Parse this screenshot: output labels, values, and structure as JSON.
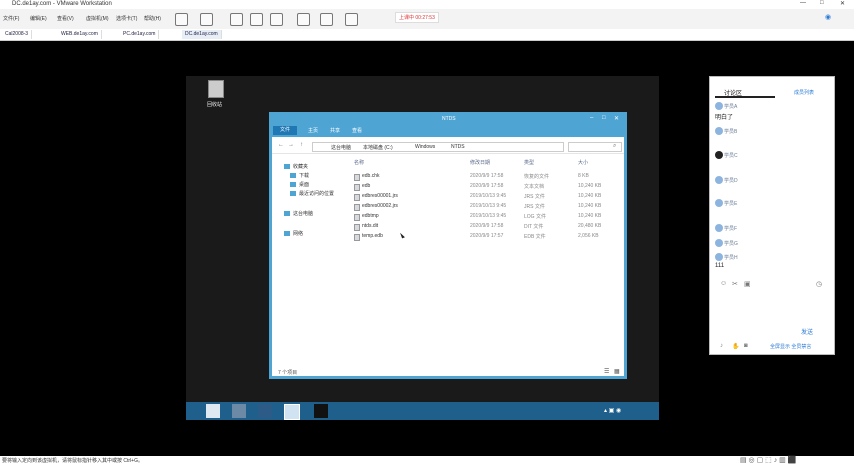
{
  "vmware": {
    "title": "DC.de1ay.com - VMware Workstation",
    "menu": [
      "文件(F)",
      "编辑(E)",
      "查看(V)",
      "虚拟机(M)",
      "选项卡(T)",
      "帮助(H)"
    ],
    "timer": "上课中 00:27:53",
    "tabs": [
      "Cal2008-3",
      "WEB.de1ay.com",
      "PC.de1ay.com",
      "DC.de1ay.com"
    ]
  },
  "desktop": {
    "recycle_bin_label": "回收站"
  },
  "explorer": {
    "title": "NTDS",
    "ribbon_tabs": [
      "文件",
      "主页",
      "共享",
      "查看"
    ],
    "breadcrumb": [
      "这台电脑",
      "本地磁盘 (C:)",
      "Windows",
      "NTDS"
    ],
    "nav_items": [
      {
        "label": "收藏夹",
        "icon": "star-icon"
      },
      {
        "label": "下载",
        "icon": "download-icon"
      },
      {
        "label": "桌面",
        "icon": "desktop-icon"
      },
      {
        "label": "最近访问的位置",
        "icon": "recent-icon"
      },
      {
        "label": "这台电脑",
        "icon": "computer-icon"
      },
      {
        "label": "网络",
        "icon": "network-icon"
      }
    ],
    "columns": [
      "名称",
      "修改日期",
      "类型",
      "大小"
    ],
    "files": [
      {
        "name": "edb.chk",
        "date": "2020/9/9 17:58",
        "type": "恢复的文件",
        "size": "8 KB"
      },
      {
        "name": "edb",
        "date": "2020/9/9 17:58",
        "type": "文本文档",
        "size": "10,240 KB"
      },
      {
        "name": "edbres00001.jrs",
        "date": "2019/10/13 9:45",
        "type": "JRS 文件",
        "size": "10,240 KB"
      },
      {
        "name": "edbres00002.jrs",
        "date": "2019/10/13 9:45",
        "type": "JRS 文件",
        "size": "10,240 KB"
      },
      {
        "name": "edbtmp",
        "date": "2019/10/13 9:45",
        "type": "LOG 文件",
        "size": "10,240 KB"
      },
      {
        "name": "ntds.dit",
        "date": "2020/9/9 17:58",
        "type": "DIT 文件",
        "size": "20,480 KB"
      },
      {
        "name": "temp.edb",
        "date": "2020/9/9 17:57",
        "type": "EDB 文件",
        "size": "2,056 KB"
      }
    ],
    "status": "7 个项目"
  },
  "chat": {
    "tab": "讨论区",
    "extra": "成员列表",
    "messages": [
      {
        "name": "学员A",
        "text": "明白了"
      },
      {
        "name": "学员B",
        "text": ""
      },
      {
        "name": "学员C",
        "text": ""
      },
      {
        "name": "学员D",
        "text": ""
      },
      {
        "name": "学员E",
        "text": ""
      },
      {
        "name": "学员F",
        "text": ""
      },
      {
        "name": "学员G",
        "text": ""
      },
      {
        "name": "学员H",
        "text": "111"
      }
    ],
    "send_label": "发送",
    "footer": "全屏显示 全员禁言"
  },
  "host_status": "要将输入定向到该虚拟机，请将鼠标指针移入其中或按 Ctrl+G。"
}
